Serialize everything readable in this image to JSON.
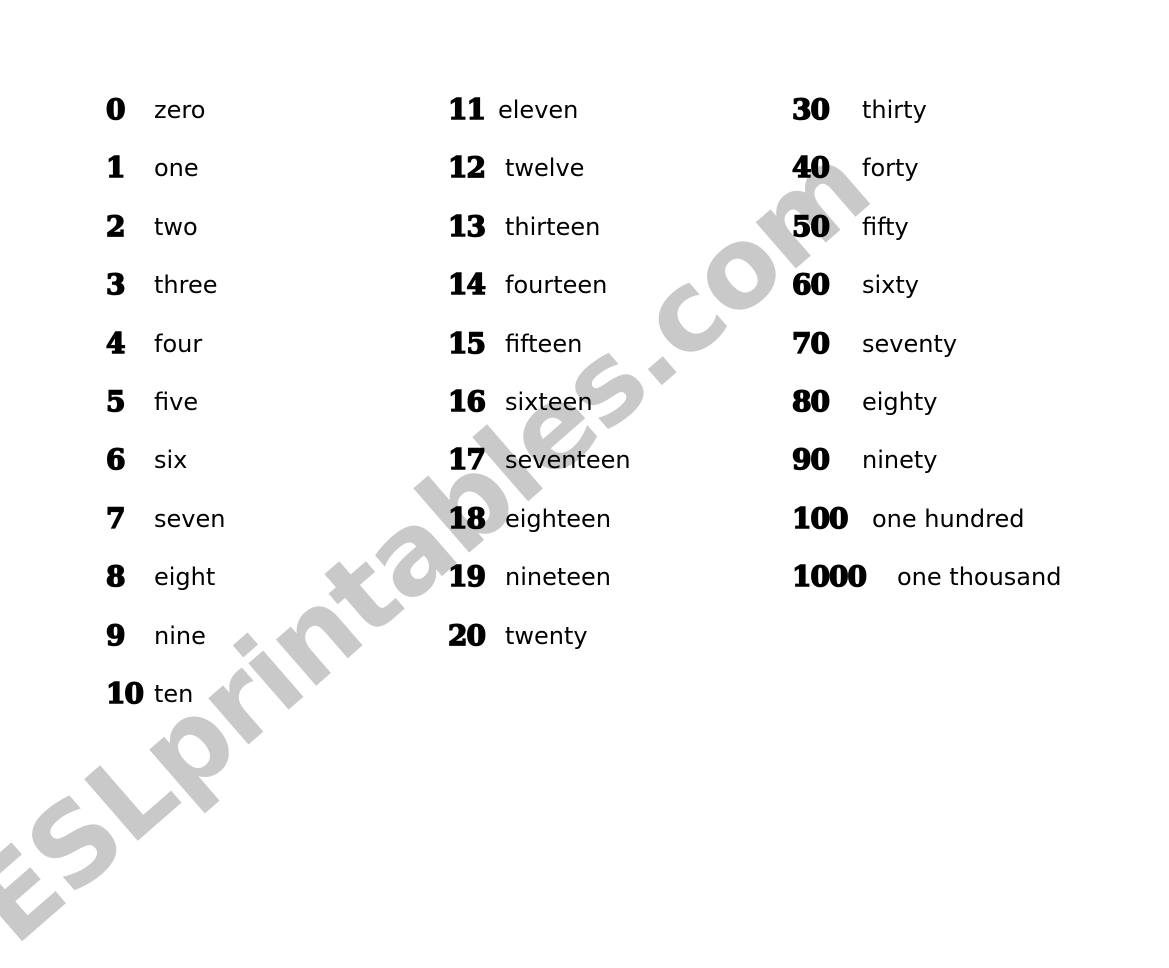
{
  "watermark": "ESLprintables.com",
  "columns": [
    [
      {
        "number": "0",
        "word": "zero"
      },
      {
        "number": "1",
        "word": "one"
      },
      {
        "number": "2",
        "word": "two"
      },
      {
        "number": "3",
        "word": "three"
      },
      {
        "number": "4",
        "word": "four"
      },
      {
        "number": "5",
        "word": "five"
      },
      {
        "number": "6",
        "word": "six"
      },
      {
        "number": "7",
        "word": "seven"
      },
      {
        "number": "8",
        "word": "eight"
      },
      {
        "number": "9",
        "word": "nine"
      },
      {
        "number": "10",
        "word": "ten"
      }
    ],
    [
      {
        "number": "11",
        "word": "eleven"
      },
      {
        "number": "12",
        "word": "twelve"
      },
      {
        "number": "13",
        "word": "thirteen"
      },
      {
        "number": "14",
        "word": "fourteen"
      },
      {
        "number": "15",
        "word": "fifteen"
      },
      {
        "number": "16",
        "word": "sixteen"
      },
      {
        "number": "17",
        "word": "seventeen"
      },
      {
        "number": "18",
        "word": "eighteen"
      },
      {
        "number": "19",
        "word": "nineteen"
      },
      {
        "number": "20",
        "word": "twenty"
      }
    ],
    [
      {
        "number": "30",
        "word": "thirty"
      },
      {
        "number": "40",
        "word": "forty"
      },
      {
        "number": "50",
        "word": "fifty"
      },
      {
        "number": "60",
        "word": "sixty"
      },
      {
        "number": "70",
        "word": "seventy"
      },
      {
        "number": "80",
        "word": "eighty"
      },
      {
        "number": "90",
        "word": "ninety"
      },
      {
        "number": "100",
        "word": "one hundred"
      },
      {
        "number": "1000",
        "word": "one thousand"
      }
    ]
  ]
}
